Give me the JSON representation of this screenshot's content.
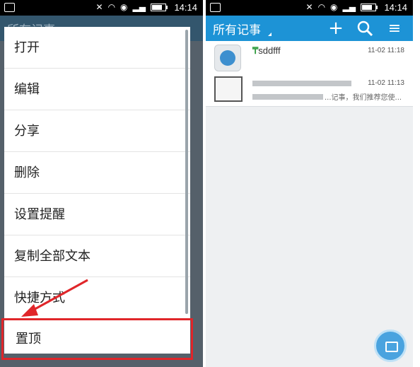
{
  "status_bar": {
    "time": "14:14"
  },
  "left_screen": {
    "background_title": "所有记事",
    "menu_items": [
      "打开",
      "编辑",
      "分享",
      "删除",
      "设置提醒",
      "复制全部文本",
      "快捷方式",
      "置顶"
    ],
    "highlighted_item": "置顶",
    "highlight_color": "#e0262a"
  },
  "right_screen": {
    "app_title": "所有记事",
    "toolbar_icons": [
      "add-icon",
      "search-icon",
      "menu-icon"
    ],
    "notes": [
      {
        "title": "sddfff",
        "date": "11-02 11:18"
      },
      {
        "title": "...记事...",
        "date": "11-02 11:13",
        "preview": "...记事，我们推荐您使..."
      }
    ],
    "fab_icon": "camera-icon",
    "accent_color": "#1d93d6"
  }
}
